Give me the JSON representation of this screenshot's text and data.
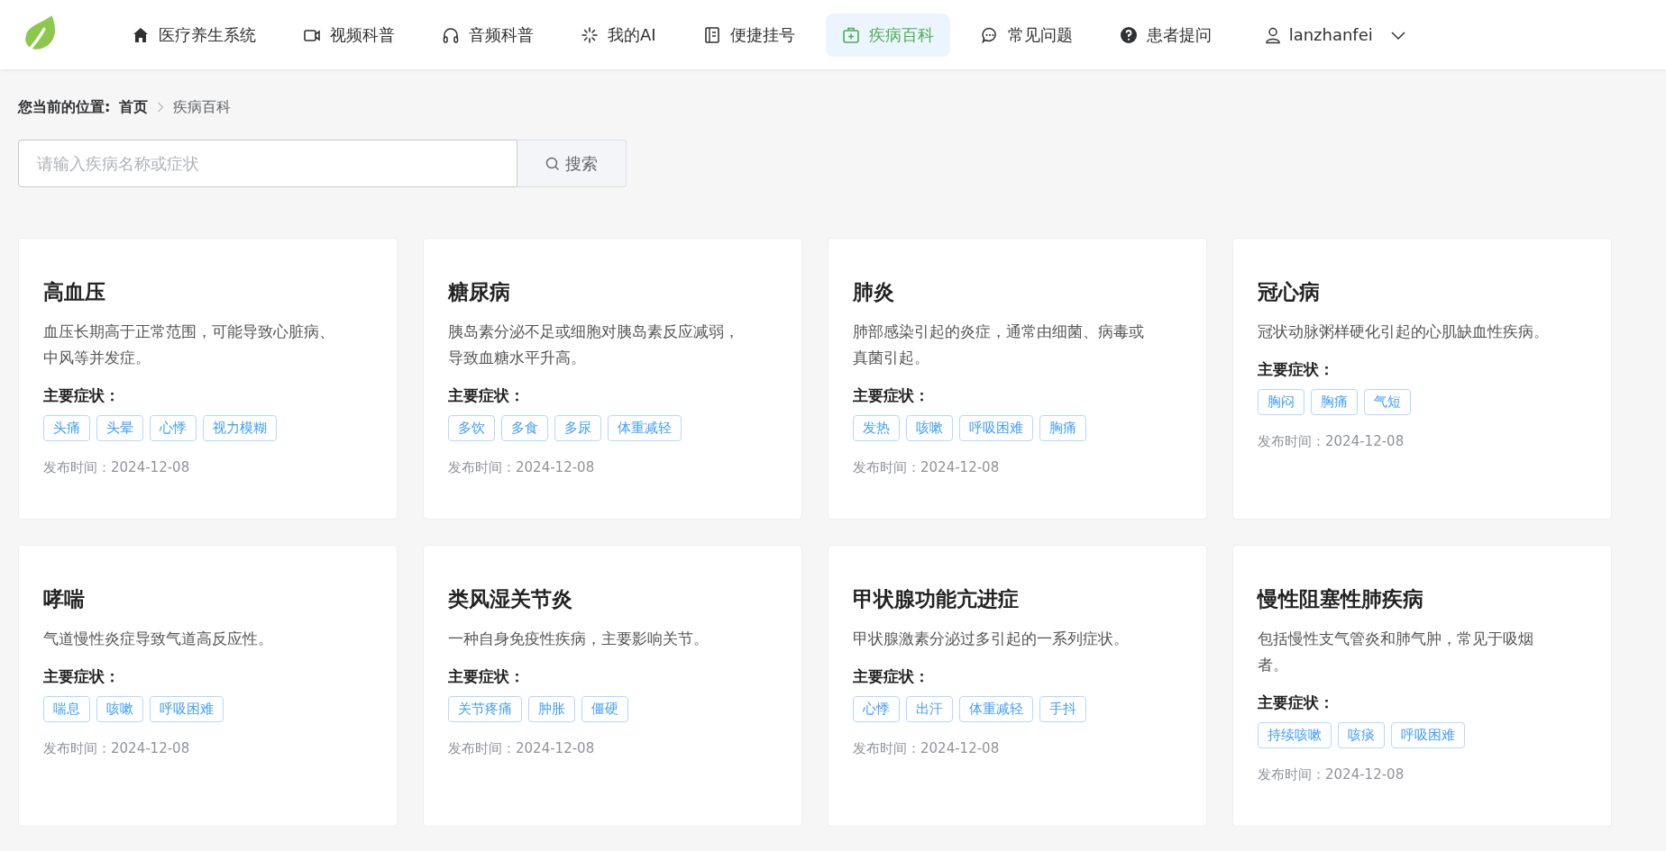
{
  "nav": {
    "items": [
      {
        "label": "医疗养生系统",
        "selected": false
      },
      {
        "label": "视频科普",
        "selected": false
      },
      {
        "label": "音频科普",
        "selected": false
      },
      {
        "label": "我的AI",
        "selected": false
      },
      {
        "label": "便捷挂号",
        "selected": false
      },
      {
        "label": "疾病百科",
        "selected": true
      },
      {
        "label": "常见问题",
        "selected": false
      },
      {
        "label": "患者提问",
        "selected": false
      }
    ],
    "user": "lanzhanfei"
  },
  "breadcrumb": {
    "label": "您当前的位置:",
    "items": [
      "首页",
      "疾病百科"
    ]
  },
  "search": {
    "placeholder": "请输入疾病名称或症状",
    "button": "搜索"
  },
  "cards": [
    {
      "title": "高血压",
      "description": "血压长期高于正常范围，可能导致心脏病、中风等并发症。",
      "symptoms": [
        "头痛",
        "头晕",
        "心悸",
        "视力模糊"
      ],
      "symptoms_label": "主要症状：",
      "date_label": "发布时间：",
      "date": "2024-12-08"
    },
    {
      "title": "糖尿病",
      "description": "胰岛素分泌不足或细胞对胰岛素反应减弱，导致血糖水平升高。",
      "symptoms": [
        "多饮",
        "多食",
        "多尿",
        "体重减轻"
      ],
      "symptoms_label": "主要症状：",
      "date_label": "发布时间：",
      "date": "2024-12-08"
    },
    {
      "title": "肺炎",
      "description": "肺部感染引起的炎症，通常由细菌、病毒或真菌引起。",
      "symptoms": [
        "发热",
        "咳嗽",
        "呼吸困难",
        "胸痛"
      ],
      "symptoms_label": "主要症状：",
      "date_label": "发布时间：",
      "date": "2024-12-08"
    },
    {
      "title": "冠心病",
      "description": "冠状动脉粥样硬化引起的心肌缺血性疾病。",
      "symptoms": [
        "胸闷",
        "胸痛",
        "气短"
      ],
      "symptoms_label": "主要症状：",
      "date_label": "发布时间：",
      "date": "2024-12-08"
    },
    {
      "title": "哮喘",
      "description": "气道慢性炎症导致气道高反应性。",
      "symptoms": [
        "喘息",
        "咳嗽",
        "呼吸困难"
      ],
      "symptoms_label": "主要症状：",
      "date_label": "发布时间：",
      "date": "2024-12-08"
    },
    {
      "title": "类风湿关节炎",
      "description": "一种自身免疫性疾病，主要影响关节。",
      "symptoms": [
        "关节疼痛",
        "肿胀",
        "僵硬"
      ],
      "symptoms_label": "主要症状：",
      "date_label": "发布时间：",
      "date": "2024-12-08"
    },
    {
      "title": "甲状腺功能亢进症",
      "description": "甲状腺激素分泌过多引起的一系列症状。",
      "symptoms": [
        "心悸",
        "出汗",
        "体重减轻",
        "手抖"
      ],
      "symptoms_label": "主要症状：",
      "date_label": "发布时间：",
      "date": "2024-12-08"
    },
    {
      "title": "慢性阻塞性肺疾病",
      "description": "包括慢性支气管炎和肺气肿，常见于吸烟者。",
      "symptoms": [
        "持续咳嗽",
        "咳痰",
        "呼吸困难"
      ],
      "symptoms_label": "主要症状：",
      "date_label": "发布时间：",
      "date": "2024-12-08"
    }
  ]
}
